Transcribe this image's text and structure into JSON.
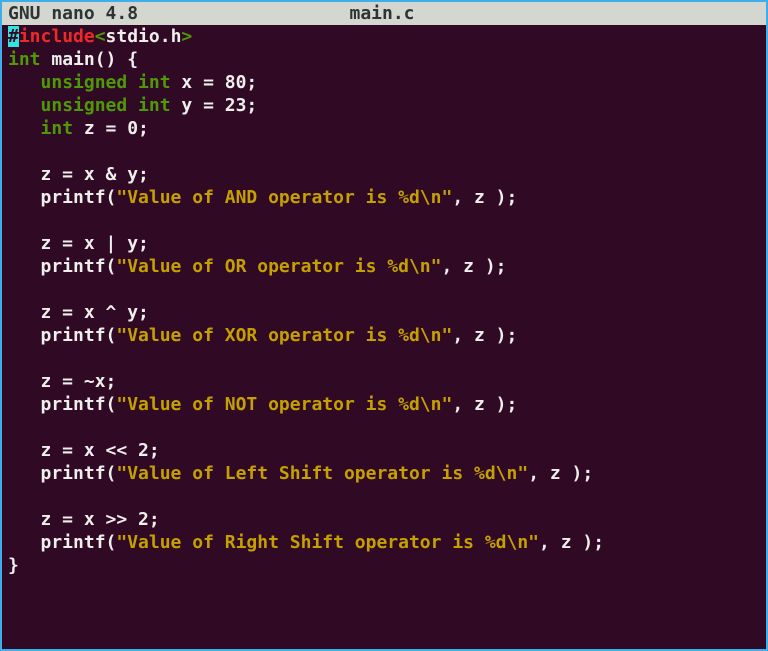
{
  "titlebar": {
    "app": "GNU nano 4.8",
    "filename": "main.c"
  },
  "code": {
    "l1_hash": "#",
    "l1_include": "include",
    "l1_open": "<",
    "l1_hdr": "stdio.h",
    "l1_close": ">",
    "l2_int": "int",
    "l2_rest": " main() {",
    "l3_ind": "   ",
    "l3_type": "unsigned int",
    "l3_rest": " x = 80;",
    "l4_ind": "   ",
    "l4_type": "unsigned int",
    "l4_rest": " y = 23;",
    "l5_ind": "   ",
    "l5_type": "int",
    "l5_rest": " z = 0;",
    "l7": "   z = x & y;",
    "l8a": "   printf(",
    "l8s": "\"Value of AND operator is %d\\n\"",
    "l8b": ", z );",
    "l10": "   z = x | y;",
    "l11a": "   printf(",
    "l11s": "\"Value of OR operator is %d\\n\"",
    "l11b": ", z );",
    "l13": "   z = x ^ y;",
    "l14a": "   printf(",
    "l14s": "\"Value of XOR operator is %d\\n\"",
    "l14b": ", z );",
    "l16": "   z = ~x;",
    "l17a": "   printf(",
    "l17s": "\"Value of NOT operator is %d\\n\"",
    "l17b": ", z );",
    "l19": "   z = x << 2;",
    "l20a": "   printf(",
    "l20s": "\"Value of Left Shift operator is %d\\n\"",
    "l20b": ", z );",
    "l22": "   z = x >> 2;",
    "l23a": "   printf(",
    "l23s": "\"Value of Right Shift operator is %d\\n\"",
    "l23b": ", z );",
    "l24": "}"
  }
}
